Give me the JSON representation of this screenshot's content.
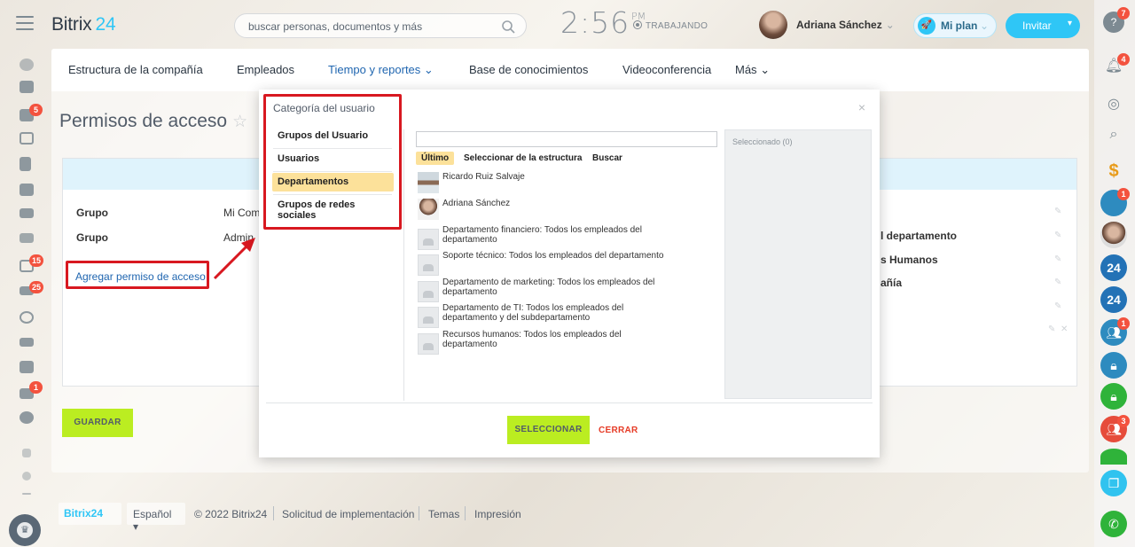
{
  "header": {
    "logo_name": "Bitrix",
    "logo_num": "24",
    "search_placeholder": "buscar personas, documentos y más",
    "clock": "2:56",
    "clock_suffix": "PM",
    "work_status": "TRABAJANDO",
    "user_name": "Adriana Sánchez",
    "plan_label": "Mi plan",
    "invite_label": "Invitar"
  },
  "nav": {
    "items": [
      "Estructura de la compañía",
      "Empleados",
      "Tiempo y reportes",
      "Base de conocimientos",
      "Videoconferencia",
      "Más"
    ]
  },
  "page": {
    "title": "Permisos de acceso",
    "rows": [
      {
        "label": "Grupo",
        "value": "Mi Com"
      },
      {
        "label": "Grupo",
        "value": "Admin"
      }
    ],
    "right_values": [
      "l departamento",
      "s Humanos",
      "añía"
    ],
    "add_link": "Agregar permiso de acceso",
    "save_label": "GUARDAR"
  },
  "popup": {
    "category_title": "Categoría del usuario",
    "categories": [
      "Grupos del Usuario",
      "Usuarios",
      "Departamentos",
      "Grupos de redes sociales"
    ],
    "selected_category": "Departamentos",
    "tabs": [
      "Último",
      "Seleccionar de la estructura",
      "Buscar"
    ],
    "list": [
      "Ricardo Ruiz Salvaje",
      "Adriana Sánchez",
      "Departamento financiero: Todos los empleados del departamento",
      "Soporte técnico: Todos los empleados del departamento",
      "Departamento de marketing: Todos los empleados del departamento",
      "Departamento de TI: Todos los empleados del departamento y del subdepartamento",
      "Recursos humanos: Todos los empleados del departamento"
    ],
    "selected_header": "Seleccionado (0)",
    "select_label": "SELECCIONAR",
    "close_label": "CERRAR"
  },
  "footer": {
    "logo": "Bitrix24",
    "lang": "Español",
    "copyright": "© 2022 Bitrix24",
    "links": [
      "Solicitud de implementación",
      "Temas",
      "Impresión"
    ]
  },
  "left_badges": [
    "5",
    "15",
    "25",
    "1"
  ],
  "right_badges": [
    "7",
    "4",
    "1",
    "1",
    "3"
  ],
  "colors": {
    "accent": "#2fc6f6",
    "highlight": "#d81820",
    "button_green": "#bbed21"
  }
}
